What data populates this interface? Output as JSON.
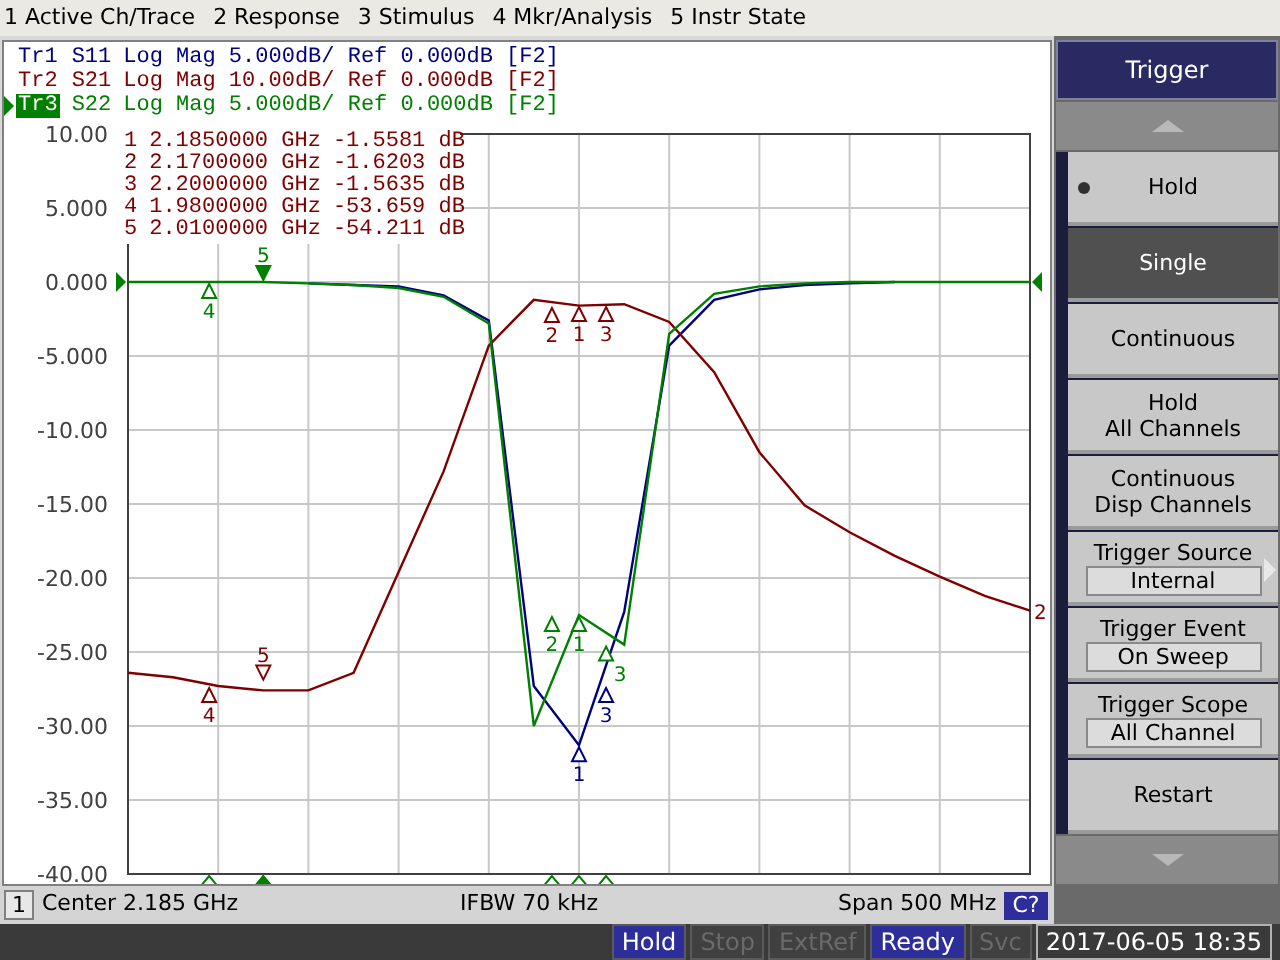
{
  "menu": [
    "1 Active Ch/Trace",
    "2 Response",
    "3 Stimulus",
    "4 Mkr/Analysis",
    "5 Instr State"
  ],
  "traces": [
    {
      "label": "Tr1",
      "format": "Log Mag 5.000dB/ Ref 0.000dB [F2]",
      "selected": false,
      "markers": [
        {
          "number": "1",
          "selected": false
        },
        {
          "number": "3",
          "selected": false
        }
      ]
    },
    {
      "label": "Tr2",
      "format": "Log Mag 10.00dB/ Ref 0.000dB [F2]",
      "selected": false,
      "end_label": "2",
      "markers": [
        {
          "number": "4",
          "selected": false
        },
        {
          "number": "5",
          "selected": false
        },
        {
          "number": "2",
          "selected": false
        },
        {
          "number": "1",
          "selected": false
        },
        {
          "number": "3",
          "selected": false
        }
      ]
    },
    {
      "label": "Tr3",
      "format": "Log Mag 5.000dB/ Ref 0.000dB [F2]",
      "selected": true,
      "markers": [
        {
          "number": "4",
          "selected": false
        },
        {
          "number": "5",
          "selected": true
        },
        {
          "number": "2",
          "selected": false
        },
        {
          "number": "1",
          "selected": false
        },
        {
          "number": "3",
          "selected": false
        }
      ]
    }
  ],
  "marker_readout": [
    {
      "number": "1",
      "frequency": "2.1850000 GHz",
      "value": "-1.5581 dB"
    },
    {
      "number": "2",
      "frequency": "2.1700000 GHz",
      "value": "-1.6203 dB"
    },
    {
      "number": "3",
      "frequency": "2.2000000 GHz",
      "value": "-1.5635 dB"
    },
    {
      "number": "4",
      "frequency": "1.9800000 GHz",
      "value": "-53.659 dB"
    },
    {
      "number": "5",
      "frequency": "2.0100000 GHz",
      "value": "-54.211 dB"
    }
  ],
  "chart_data": {
    "type": "line",
    "grid": true,
    "ylim": [
      -40,
      10
    ],
    "categories": [
      null,
      null,
      null,
      null,
      null,
      null,
      null,
      null,
      null,
      null,
      null,
      null,
      null,
      null,
      null,
      null,
      null,
      null,
      null,
      null,
      null
    ],
    "yticks": [
      {
        "value": 10,
        "label": "10.00"
      },
      {
        "value": 5,
        "label": "5.000"
      },
      {
        "value": 0,
        "label": "0.000"
      },
      {
        "value": -5,
        "label": "-5.000"
      },
      {
        "value": -10,
        "label": "-10.00"
      },
      {
        "value": -15,
        "label": "-15.00"
      },
      {
        "value": -20,
        "label": "-20.00"
      },
      {
        "value": -25,
        "label": "-25.00"
      },
      {
        "value": -30,
        "label": "-30.00"
      },
      {
        "value": -35,
        "label": "-35.00"
      },
      {
        "value": -40,
        "label": "-40.00"
      }
    ],
    "series": [
      {
        "name": "S11",
        "color": "#000080",
        "values": [
          null,
          null,
          null,
          null,
          -0.1,
          -0.2,
          -0.3,
          -0.9,
          -2.6,
          -27.3,
          -31.3,
          -22.3,
          -4.3,
          -1.2,
          -0.5,
          -0.2,
          -0.1,
          0,
          null,
          null,
          null
        ]
      },
      {
        "name": "S21",
        "color": "#800000",
        "values": [
          -26.4,
          -26.7,
          -27.3,
          -27.6,
          -27.6,
          -26.4,
          -19.6,
          -12.8,
          -4.3,
          -1.2,
          -1.6,
          -1.5,
          -2.7,
          -6.1,
          -11.5,
          -15.1,
          -16.9,
          -18.5,
          -19.9,
          -21.2,
          -22.2
        ]
      },
      {
        "name": "S22",
        "color": "#008000",
        "values": [
          0,
          0,
          0,
          0,
          -0.1,
          -0.2,
          -0.4,
          -1.0,
          -2.8,
          -30,
          -22.5,
          -24.5,
          -3.5,
          -0.8,
          -0.3,
          -0.1,
          0,
          0,
          0,
          0,
          0
        ]
      }
    ]
  },
  "channel_bar": {
    "channel": "1",
    "center": "Center 2.185 GHz",
    "ifbw": "IFBW 70 kHz",
    "span": "Span 500 MHz",
    "status": "C?"
  },
  "softkeys": {
    "title": "Trigger",
    "items": [
      {
        "kind": "button",
        "label": "Hold",
        "checked": true,
        "selected": false
      },
      {
        "kind": "button",
        "label": "Single",
        "checked": false,
        "selected": true
      },
      {
        "kind": "button",
        "label": "Continuous",
        "checked": false,
        "selected": false
      },
      {
        "kind": "button",
        "label": "Hold\nAll Channels",
        "checked": false,
        "selected": false
      },
      {
        "kind": "button",
        "label": "Continuous\nDisp Channels",
        "checked": false,
        "selected": false
      },
      {
        "kind": "value",
        "label": "Trigger Source",
        "value": "Internal",
        "submenu": true,
        "selected": false
      },
      {
        "kind": "value",
        "label": "Trigger Event",
        "value": "On Sweep",
        "submenu": false,
        "selected": false
      },
      {
        "kind": "value",
        "label": "Trigger Scope",
        "value": "All Channel",
        "submenu": false,
        "selected": false
      },
      {
        "kind": "button",
        "label": "Restart",
        "checked": false,
        "selected": false
      }
    ]
  },
  "status_bar": {
    "flags": [
      {
        "label": "Hold",
        "on": true
      },
      {
        "label": "Stop",
        "on": false
      },
      {
        "label": "ExtRef",
        "on": false
      },
      {
        "label": "Ready",
        "on": true
      },
      {
        "label": "Svc",
        "on": false
      }
    ],
    "datetime": "2017-06-05 18:35"
  }
}
